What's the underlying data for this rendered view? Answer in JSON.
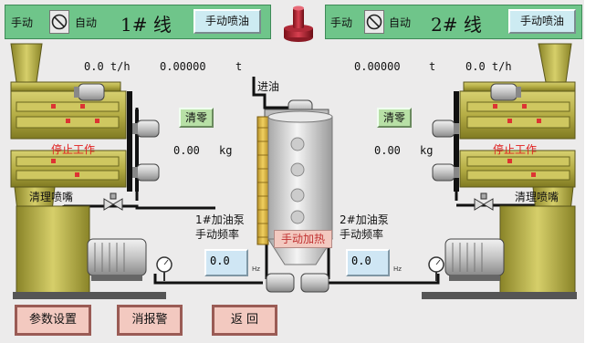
{
  "line1": {
    "manual_label": "手动",
    "auto_label": "自动",
    "title": "1# 线",
    "spray_button": "手动喷油",
    "rate": "0.0 t/h",
    "total": "0.00000",
    "total_unit": "t",
    "clear_button": "清零",
    "weight": "0.00",
    "weight_unit": "kg",
    "stop_status": "停止工作",
    "clean_nozzle_label": "清理喷嘴",
    "pump_label_1": "1#加油泵",
    "pump_label_2": "手动频率",
    "freq_value": "0.0",
    "freq_unit": "Hz"
  },
  "line2": {
    "manual_label": "手动",
    "auto_label": "自动",
    "title": "2# 线",
    "spray_button": "手动喷油",
    "rate": "0.0 t/h",
    "total": "0.00000",
    "total_unit": "t",
    "clear_button": "清零",
    "weight": "0.00",
    "weight_unit": "kg",
    "stop_status": "停止工作",
    "clean_nozzle_label": "清理喷嘴",
    "pump_label_1": "2#加油泵",
    "pump_label_2": "手动频率",
    "freq_value": "0.0",
    "freq_unit": "Hz"
  },
  "tank": {
    "inlet_label": "进油",
    "heat_button": "手动加热"
  },
  "footer": {
    "params_button": "参数设置",
    "clear_alarm_button": "消报警",
    "back_button": "返 回"
  },
  "colors": {
    "header_green": "#6fc58a",
    "machine_olive": "#b5ad45",
    "status_red": "#e02020",
    "tank_silver": "#d0d0d0",
    "heater_yellow": "#e6c040",
    "button_pink": "#f3c9c0"
  }
}
